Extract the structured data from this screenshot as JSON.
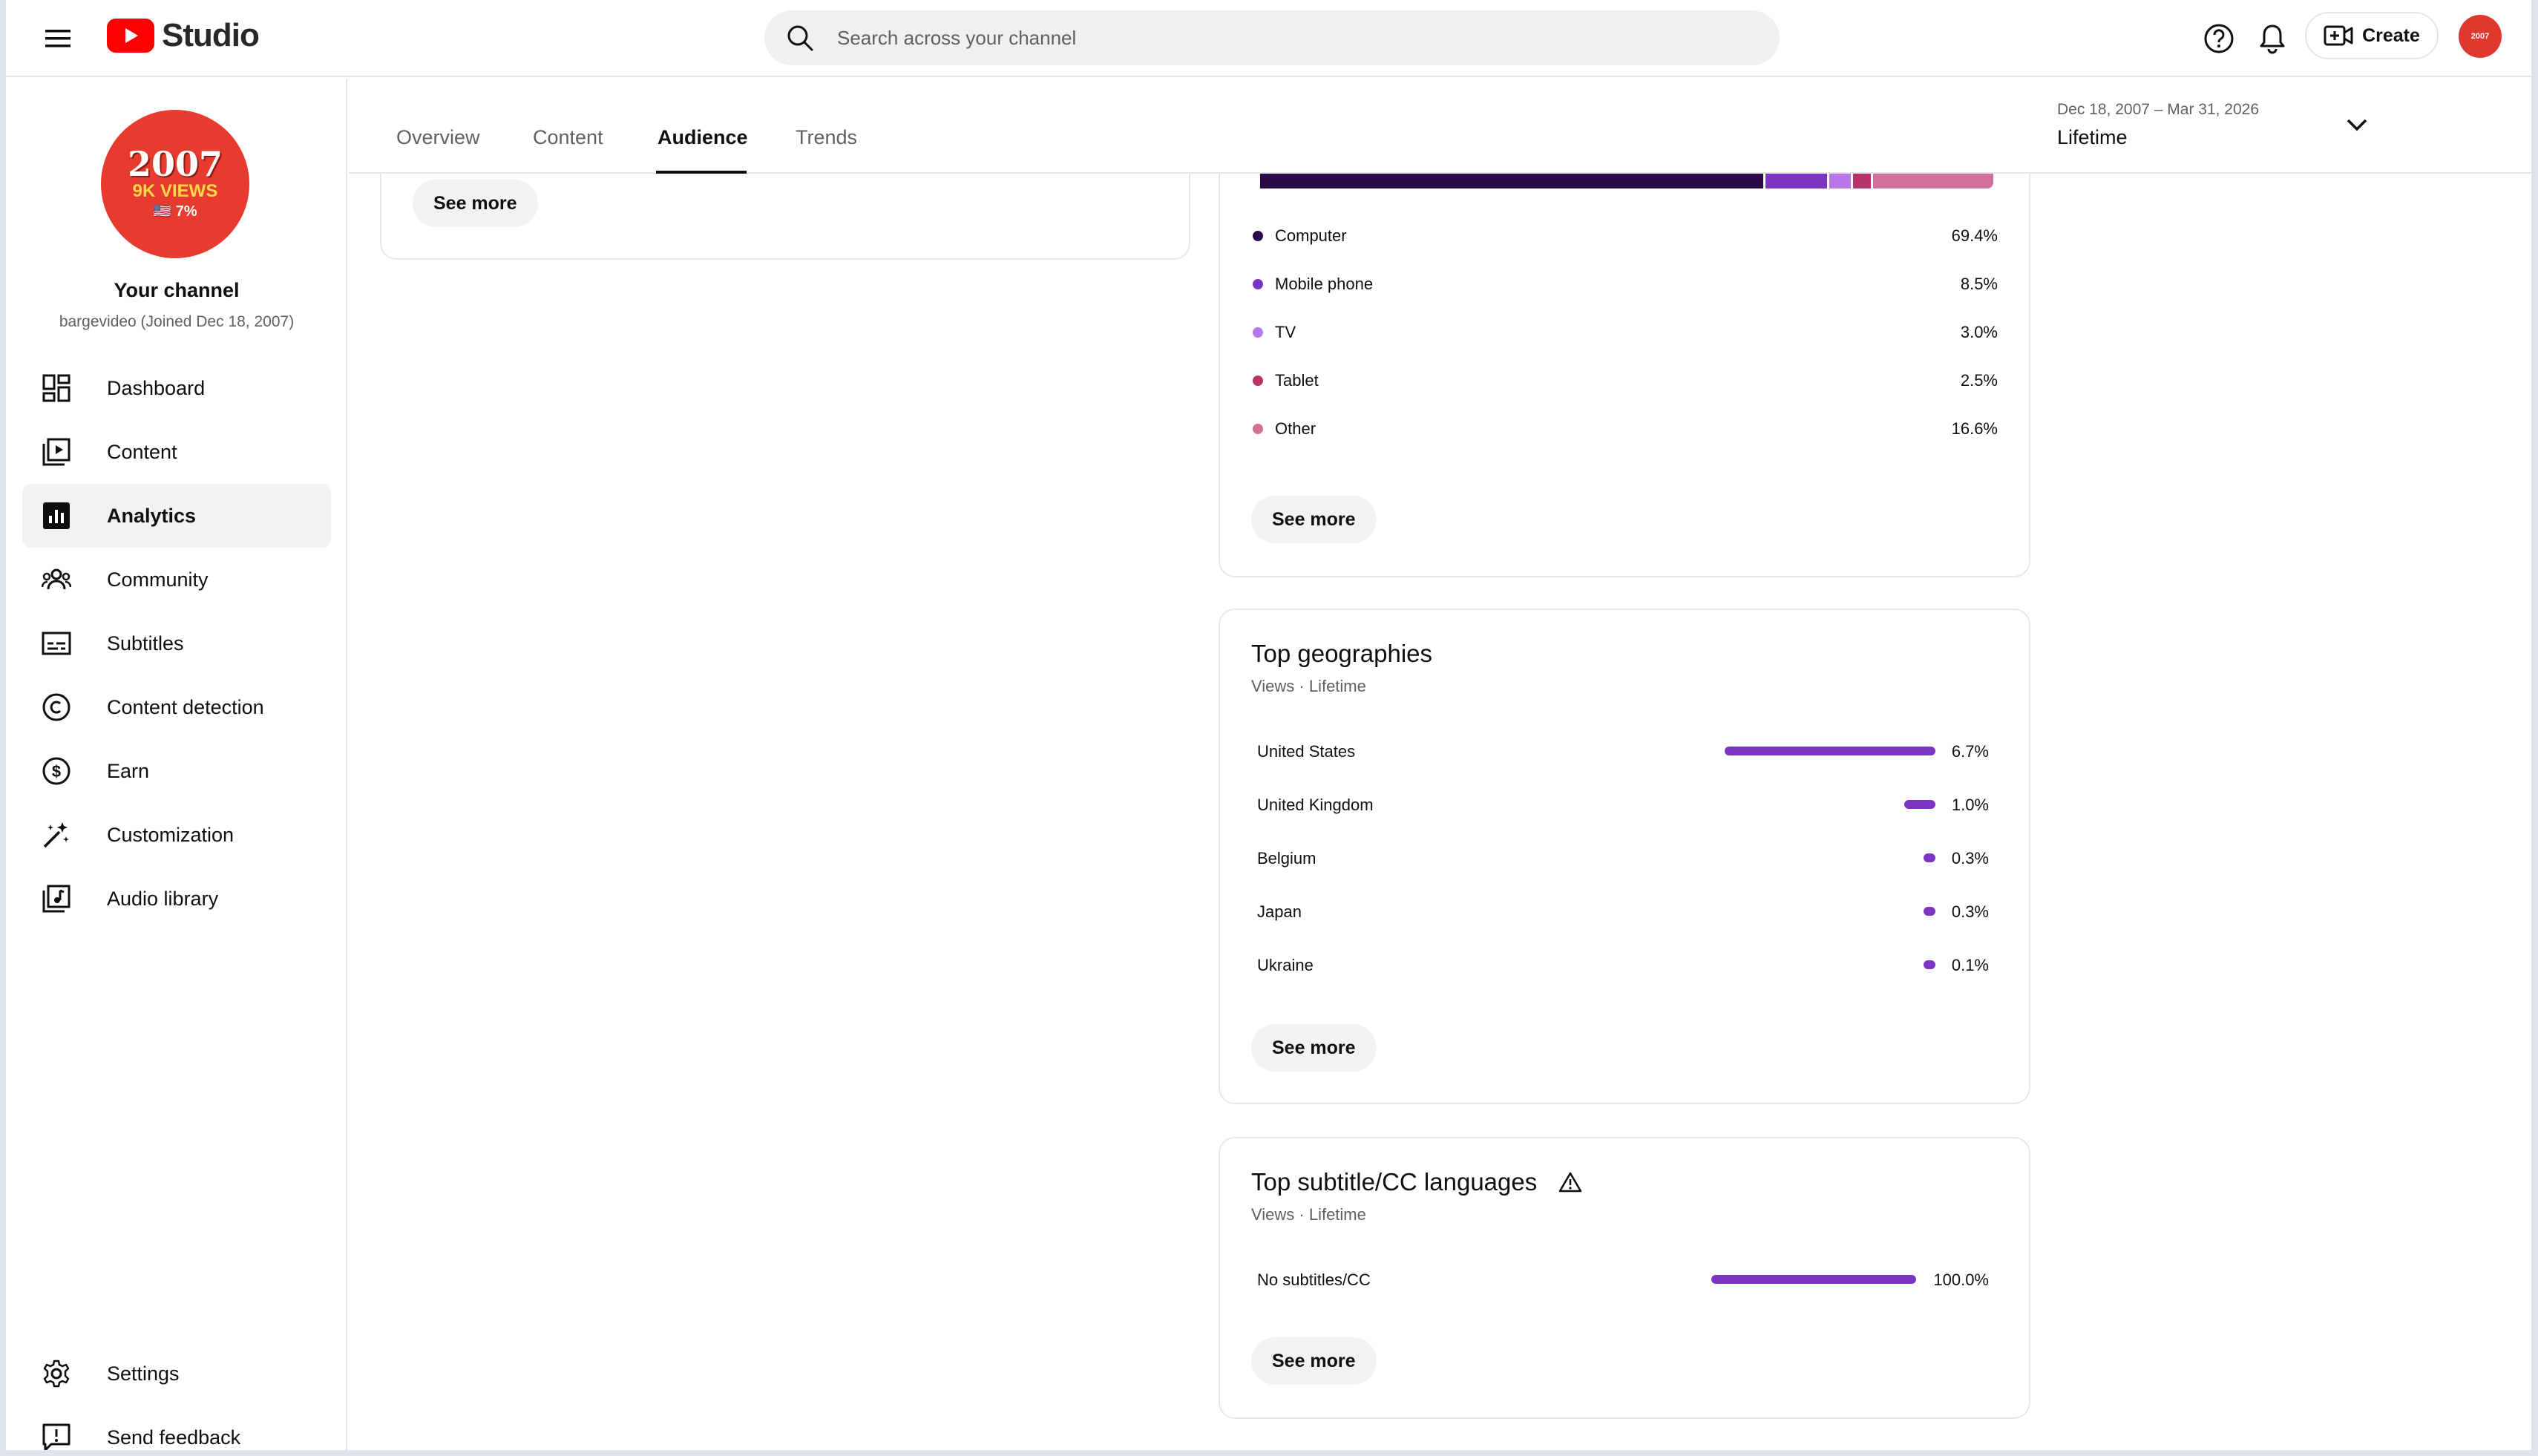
{
  "header": {
    "app_name": "Studio",
    "search_placeholder": "Search across your channel",
    "create_label": "Create",
    "avatar_text": "2007"
  },
  "sidebar": {
    "channel_avatar": {
      "year": "2007",
      "views": "9K VIEWS",
      "percent": "🇺🇸 7%"
    },
    "channel_title": "Your channel",
    "channel_sub": "bargevideo (Joined Dec 18, 2007)",
    "items": [
      {
        "label": "Dashboard",
        "icon": "dashboard-icon"
      },
      {
        "label": "Content",
        "icon": "content-icon"
      },
      {
        "label": "Analytics",
        "icon": "analytics-icon",
        "active": true
      },
      {
        "label": "Community",
        "icon": "community-icon"
      },
      {
        "label": "Subtitles",
        "icon": "subtitles-icon"
      },
      {
        "label": "Content detection",
        "icon": "copyright-icon"
      },
      {
        "label": "Earn",
        "icon": "dollar-icon"
      },
      {
        "label": "Customization",
        "icon": "magic-wand-icon"
      },
      {
        "label": "Audio library",
        "icon": "audio-library-icon"
      }
    ],
    "footer": [
      {
        "label": "Settings",
        "icon": "gear-icon"
      },
      {
        "label": "Send feedback",
        "icon": "feedback-icon"
      }
    ]
  },
  "tabs": {
    "items": [
      "Overview",
      "Content",
      "Audience",
      "Trends"
    ],
    "active": "Audience"
  },
  "date_range": {
    "range": "Dec 18, 2007 – Mar 31, 2026",
    "label": "Lifetime"
  },
  "left_card": {
    "see_more": "See more"
  },
  "device_card": {
    "see_more": "See more",
    "devices": [
      {
        "label": "Computer",
        "value": "69.4%",
        "share": 69.4,
        "color": "#2a0b4a"
      },
      {
        "label": "Mobile phone",
        "value": "8.5%",
        "share": 8.5,
        "color": "#7b35c2"
      },
      {
        "label": "TV",
        "value": "3.0%",
        "share": 3.0,
        "color": "#b877e8"
      },
      {
        "label": "Tablet",
        "value": "2.5%",
        "share": 2.5,
        "color": "#b8336a"
      },
      {
        "label": "Other",
        "value": "16.6%",
        "share": 16.6,
        "color": "#d2709a"
      }
    ]
  },
  "geo_card": {
    "title": "Top geographies",
    "sub": "Views · Lifetime",
    "see_more": "See more",
    "rows": [
      {
        "label": "United States",
        "value": "6.7%",
        "share": 6.7
      },
      {
        "label": "United Kingdom",
        "value": "1.0%",
        "share": 1.0
      },
      {
        "label": "Belgium",
        "value": "0.3%",
        "share": 0.3
      },
      {
        "label": "Japan",
        "value": "0.3%",
        "share": 0.3
      },
      {
        "label": "Ukraine",
        "value": "0.1%",
        "share": 0.1
      }
    ]
  },
  "subtitle_card": {
    "title": "Top subtitle/CC languages",
    "sub": "Views · Lifetime",
    "see_more": "See more",
    "rows": [
      {
        "label": "No subtitles/CC",
        "value": "100.0%",
        "share": 100.0
      }
    ]
  },
  "colors": {
    "accent": "#7b35c2",
    "brand_red": "#ff0000"
  }
}
